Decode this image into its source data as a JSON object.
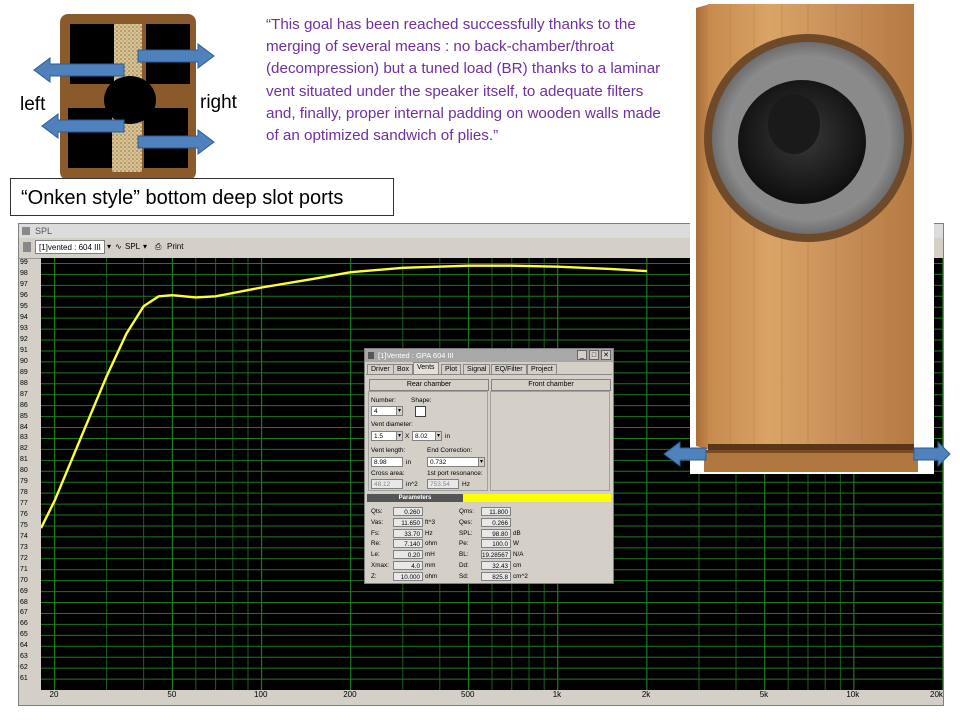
{
  "labels": {
    "left": "left",
    "right": "right"
  },
  "caption": "“Onken style” bottom deep slot ports",
  "quote": "“This goal has been reached successfully thanks to the merging of several means : no back-chamber/throat (decompression) but a tuned load (BR) thanks to a laminar vent situated under the speaker itself, to adequate filters and, finally, proper internal padding on wooden walls made of an optimized sandwich of plies.”",
  "spl_window": {
    "title": "SPL",
    "project_field": "[1]vented : 604 III",
    "mode_label": "SPL",
    "print_label": "Print"
  },
  "chart_data": {
    "type": "line",
    "x_scale": "log",
    "xlim": [
      18,
      20000
    ],
    "ylim": [
      60,
      99.5
    ],
    "y_ticks": [
      99,
      98,
      97,
      96,
      95,
      94,
      93,
      92,
      91,
      90,
      89,
      88,
      87,
      86,
      85,
      84,
      83,
      82,
      81,
      80,
      79,
      78,
      77,
      76,
      75,
      74,
      73,
      72,
      71,
      70,
      69,
      68,
      67,
      66,
      65,
      64,
      63,
      62,
      61
    ],
    "x_tick_labels": [
      {
        "v": 20,
        "label": "20"
      },
      {
        "v": 50,
        "label": "50"
      },
      {
        "v": 100,
        "label": "100"
      },
      {
        "v": 200,
        "label": "200"
      },
      {
        "v": 500,
        "label": "500"
      },
      {
        "v": 1000,
        "label": "1k"
      },
      {
        "v": 2000,
        "label": "2k"
      },
      {
        "v": 5000,
        "label": "5k"
      },
      {
        "v": 10000,
        "label": "10k"
      },
      {
        "v": 20000,
        "label": "20k"
      }
    ],
    "series": [
      {
        "color": "#ffff33",
        "x": [
          18,
          20,
          25,
          30,
          35,
          40,
          45,
          50,
          60,
          70,
          80,
          100,
          150,
          200,
          300,
          500,
          700,
          1000,
          1500,
          2000
        ],
        "y": [
          74.8,
          77.3,
          83.6,
          88.7,
          92.6,
          95.1,
          96.0,
          96.1,
          95.9,
          96.0,
          96.3,
          96.8,
          97.6,
          98.2,
          98.6,
          98.8,
          98.8,
          98.7,
          98.5,
          98.3
        ]
      }
    ],
    "grid": true,
    "background": "#000000",
    "grid_color": "#1e7a1e"
  },
  "dialog": {
    "title": "[1]Vented : GPA 604 III",
    "tabs": [
      "Driver",
      "Box",
      "Vents",
      "Plot",
      "Signal",
      "EQ/Filter",
      "Project"
    ],
    "rear_chamber": "Rear chamber",
    "front_chamber": "Front chamber",
    "number_label": "Number:",
    "number_value": "4",
    "shape_label": "Shape:",
    "vent_diameter_label": "Vent diameter:",
    "diam_a": "1.5",
    "diam_x": "X",
    "diam_b": "8.02",
    "diam_unit": "in",
    "vent_length_label": "Vent length:",
    "vent_length": "8.98",
    "vent_length_unit": "in",
    "end_corr_label": "End Correction:",
    "end_corr": "0.732",
    "cross_area_label": "Cross area:",
    "cross_area": "48.12",
    "cross_area_unit": "in^2",
    "port_res_label": "1st port resonance:",
    "port_res": "753.54",
    "port_res_unit": "Hz",
    "parameters_label": "Parameters",
    "params_left": [
      {
        "k": "Qts:",
        "v": "0.260",
        "u": ""
      },
      {
        "k": "Vas:",
        "v": "11.650",
        "u": "ft^3"
      },
      {
        "k": "Fs:",
        "v": "33.70",
        "u": "Hz"
      },
      {
        "k": "Re:",
        "v": "7.140",
        "u": "ohm"
      },
      {
        "k": "Le:",
        "v": "0.20",
        "u": "mH"
      },
      {
        "k": "Xmax:",
        "v": "4.0",
        "u": "mm"
      },
      {
        "k": "Z:",
        "v": "10.000",
        "u": "ohm"
      }
    ],
    "params_right": [
      {
        "k": "Qms:",
        "v": "11.800",
        "u": ""
      },
      {
        "k": "Qes:",
        "v": "0.266",
        "u": ""
      },
      {
        "k": "SPL:",
        "v": "98.80",
        "u": "dB"
      },
      {
        "k": "Pe:",
        "v": "100.0",
        "u": "W"
      },
      {
        "k": "BL:",
        "v": "19.28567",
        "u": "N/A"
      },
      {
        "k": "Dd:",
        "v": "32.43",
        "u": "cm"
      },
      {
        "k": "Sd:",
        "v": "825.8",
        "u": "cm^2"
      }
    ]
  }
}
